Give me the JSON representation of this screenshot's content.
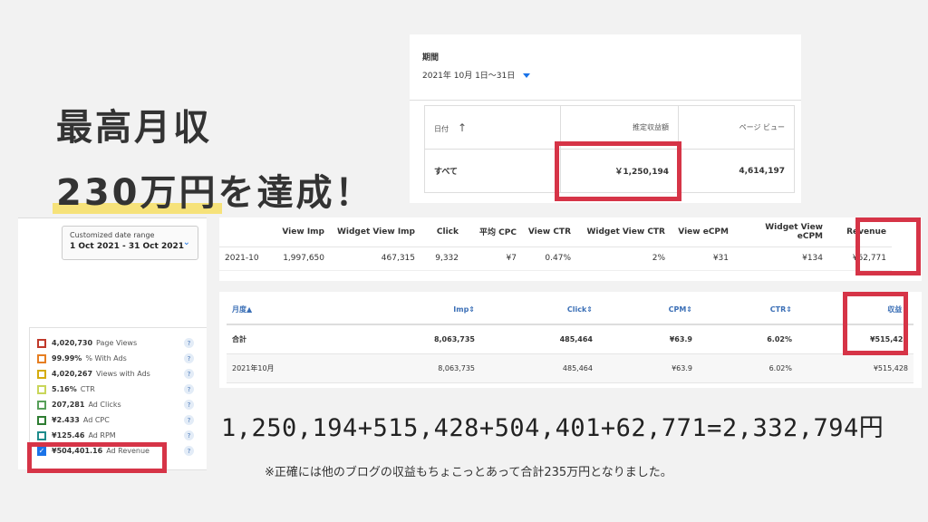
{
  "headline": {
    "line1": "最高月収",
    "line2_highlight": "230万円",
    "line2_rest": "を達成！"
  },
  "panel_a": {
    "period_label": "期間",
    "period_value": "2021年 10月 1日～31日",
    "columns": [
      "日付",
      "推定収益額",
      "ページ ビュー"
    ],
    "row": [
      "すべて",
      "￥1,250,194",
      "4,614,197"
    ]
  },
  "panel_b": {
    "date_range_label": "Customized date range",
    "date_range_value": "1 Oct 2021 - 31 Oct 2021",
    "metrics": [
      {
        "value": "4,020,730",
        "label": "Page Views",
        "color": "#c0392b",
        "checked": false
      },
      {
        "value": "99.99%",
        "label": "% With Ads",
        "color": "#e67e22",
        "checked": false
      },
      {
        "value": "4,020,267",
        "label": "Views with Ads",
        "color": "#d4ac0d",
        "checked": false
      },
      {
        "value": "5.16%",
        "label": "CTR",
        "color": "#c9d65a",
        "checked": false
      },
      {
        "value": "207,281",
        "label": "Ad Clicks",
        "color": "#58a05a",
        "checked": false
      },
      {
        "value": "¥2.433",
        "label": "Ad CPC",
        "color": "#2e7d32",
        "checked": false
      },
      {
        "value": "¥125.46",
        "label": "Ad RPM",
        "color": "#1e8c8c",
        "checked": false
      },
      {
        "value": "¥504,401.16",
        "label": "Ad Revenue",
        "color": "#1a73e8",
        "checked": true
      }
    ],
    "help_symbol": "?"
  },
  "panel_c": {
    "columns": [
      "",
      "View Imp",
      "Widget View Imp",
      "Click",
      "平均 CPC",
      "View CTR",
      "Widget View CTR",
      "View eCPM",
      "Widget View eCPM",
      "Revenue"
    ],
    "row": [
      "2021-10",
      "1,997,650",
      "467,315",
      "9,332",
      "¥7",
      "0.47%",
      "2%",
      "¥31",
      "¥134",
      "¥62,771"
    ]
  },
  "panel_d": {
    "columns": [
      "月度▲",
      "Imp⇕",
      "Click⇕",
      "CPM⇕",
      "CTR⇕",
      "収益⇕"
    ],
    "total_row": [
      "合計",
      "8,063,735",
      "485,464",
      "¥63.9",
      "6.02%",
      "¥515,428"
    ],
    "month_row": [
      "2021年10月",
      "8,063,735",
      "485,464",
      "¥63.9",
      "6.02%",
      "¥515,428"
    ]
  },
  "sum_text": "1,250,194+515,428+504,401+62,771=2,332,794円",
  "note_text": "※正確には他のブログの収益もちょこっとあって合計235万円となりました。",
  "colors": {
    "highlight_box": "#d63447",
    "marker": "#f6e27a",
    "link_blue": "#3b6fb6"
  }
}
